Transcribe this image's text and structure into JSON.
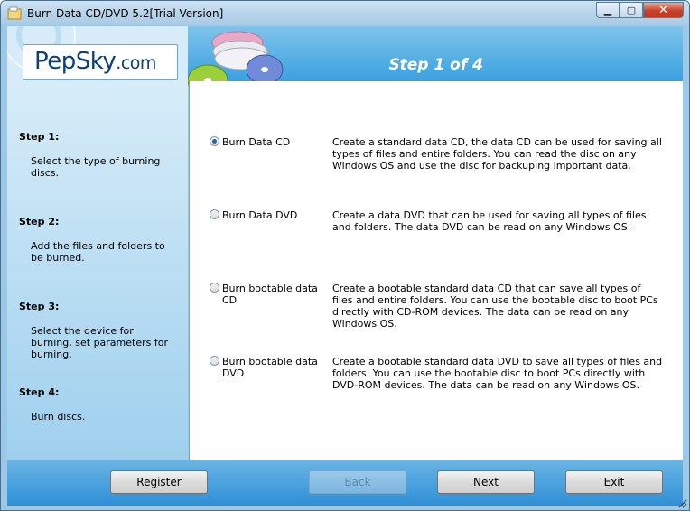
{
  "window": {
    "title": "Burn Data CD/DVD 5.2[Trial Version]"
  },
  "header": {
    "logo_main": "PepSky",
    "logo_suffix": ".com",
    "step_title": "Step 1 of 4"
  },
  "steps": [
    {
      "title": "Step 1:",
      "desc": "Select the type of burning discs."
    },
    {
      "title": "Step 2:",
      "desc": "Add the files and folders to be burned."
    },
    {
      "title": "Step 3:",
      "desc": "Select the device for burning, set parameters for burning."
    },
    {
      "title": "Step 4:",
      "desc": "Burn discs."
    }
  ],
  "options": [
    {
      "label": "Burn Data CD",
      "selected": true,
      "desc": "Create a standard data CD, the data CD can be used for saving all types of files and entire folders. You can read the disc on any Windows OS and use the disc for backuping important data."
    },
    {
      "label": "Burn Data DVD",
      "selected": false,
      "desc": "Create a data DVD that can be used for saving all types of files and folders. The data DVD can be read on any Windows OS."
    },
    {
      "label": "Burn bootable data CD",
      "selected": false,
      "desc": "Create a bootable standard data CD that can save all types of files and entire folders. You can use the bootable disc to boot PCs directly with CD-ROM devices. The data can be read on any Windows OS."
    },
    {
      "label": "Burn bootable data DVD",
      "selected": false,
      "desc": "Create a bootable standard data DVD to save all types of files and folders. You can use the bootable disc to boot PCs directly with DVD-ROM devices. The data can be read on any Windows OS."
    }
  ],
  "buttons": {
    "register": "Register",
    "back": "Back",
    "next": "Next",
    "exit": "Exit"
  },
  "icons": [
    "app-icon",
    "minimize-icon",
    "maximize-icon",
    "close-icon",
    "disc-stack-icon",
    "resize-grip-icon"
  ],
  "colors": {
    "header_blue": "#3aa1df",
    "footer_blue": "#2e8fd6",
    "close_red": "#c8412a",
    "logo_text": "#0f3f73"
  }
}
